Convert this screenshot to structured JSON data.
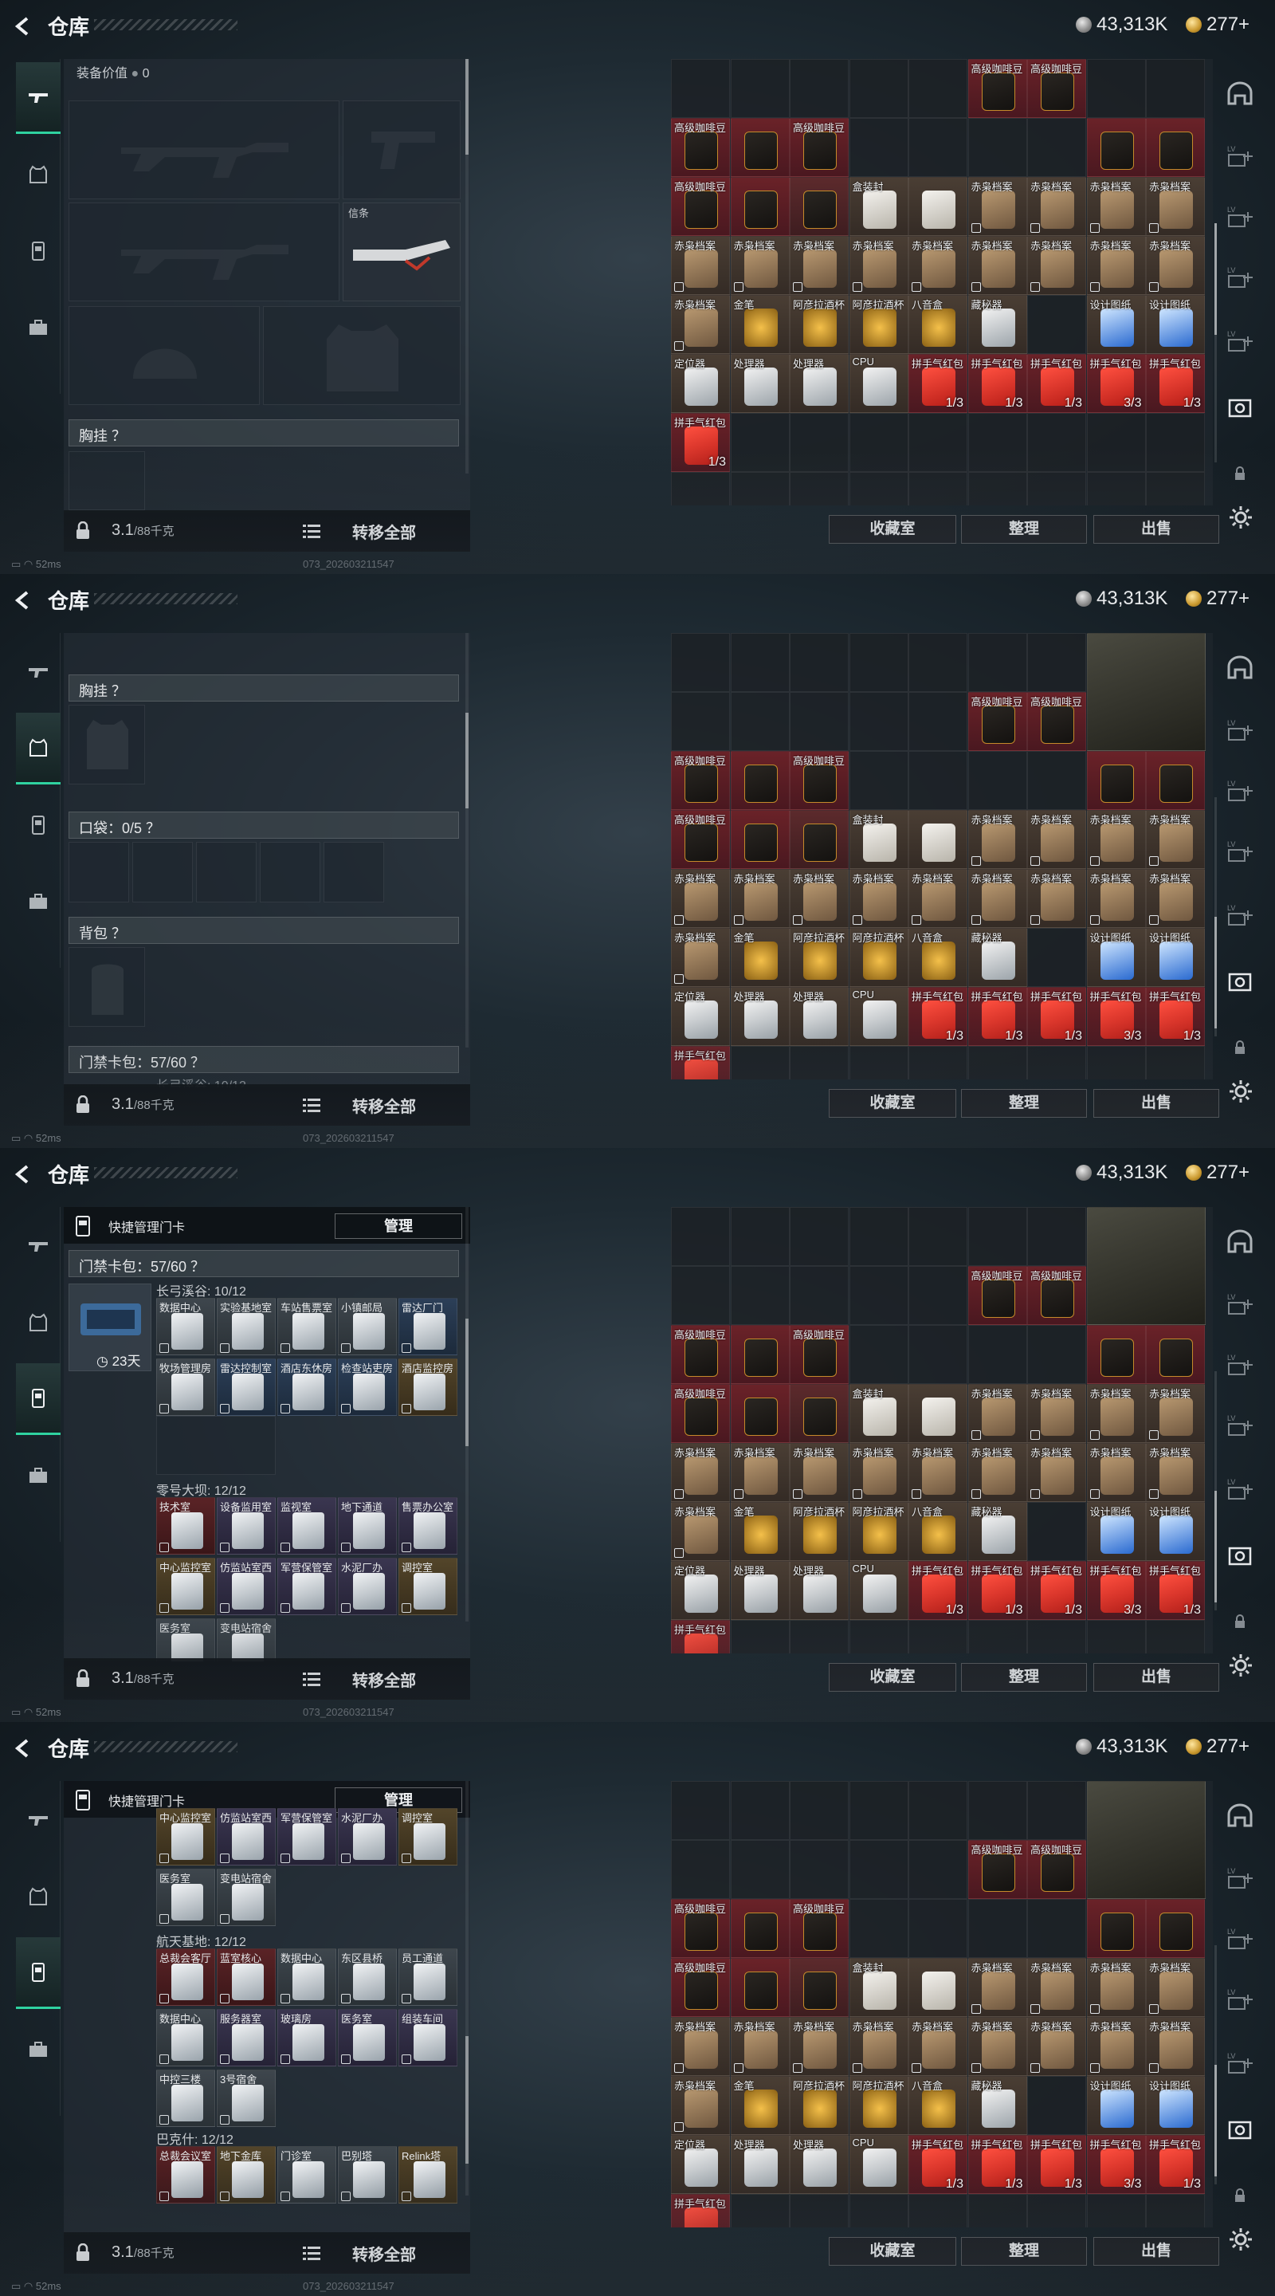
{
  "header": {
    "title": "仓库",
    "currency_silver": "43,313K",
    "currency_gold": "277+"
  },
  "status": {
    "ping": "52ms",
    "build": "073_202603211547"
  },
  "bottom": {
    "weight": "3.1",
    "weight_cap": "/88千克",
    "transfer_all": "转移全部"
  },
  "nav": [
    "firearm-tab",
    "armor-tab",
    "keycard-tab",
    "briefcase-tab"
  ],
  "loadout": {
    "equip_value_label": "装备价值",
    "equip_value": "0",
    "melee_label": "信条",
    "chest_rig": "胸挂 ？",
    "pocket": "口袋：0/5 ？",
    "backpack": "背包 ？",
    "keycard_pack": "门禁卡包：57/60 ？",
    "changgong_sub": "长弓溪谷: 10/12"
  },
  "keycard": {
    "manage_title": "快捷管理门卡",
    "manage_button": "管理",
    "case_timer": "23天",
    "group1_title": "长弓溪谷: 10/12",
    "group1": [
      "数据中心",
      "实验基地室",
      "车站售票室",
      "小镇邮局",
      "雷达厂门",
      "牧场管理房",
      "雷达控制室",
      "酒店东休房",
      "检查站吏房",
      "酒店监控房"
    ],
    "group2_title": "零号大坝: 12/12",
    "group2": [
      "技术室",
      "设备监用室",
      "监视室",
      "地下通道",
      "售票办公室",
      "中心监控室",
      "仿监站室西",
      "军营保管室",
      "水泥厂办",
      "调控室",
      "医务室",
      "变电站宿舍"
    ],
    "group3_title": "航天基地: 12/12",
    "group3": [
      "总裁会客厅",
      "蓝室核心",
      "数据中心",
      "东区县桥",
      "员工通道",
      "数据中心",
      "服务器室",
      "玻璃房",
      "医务室",
      "组装车间",
      "中控三楼",
      "3号宿舍"
    ],
    "group4_title": "巴克什: 12/12",
    "group4": [
      "总裁会议室",
      "地下金库",
      "门诊室",
      "巴别塔",
      "Relink塔"
    ],
    "group2_partial": [
      "中心监控室",
      "仿监站室西",
      "军营保管室",
      "水泥厂办",
      "调控室"
    ]
  },
  "stash": {
    "coffee": "高级咖啡豆",
    "case": "盒装封装咖啡",
    "case_short": "盒装封",
    "pheasant": "赤枭档案",
    "pen": "金笔",
    "cup": "阿彦拉酒杯",
    "clock": "八音盒",
    "secret": "藏秘器",
    "drawing": "设计图纸",
    "locator": "定位器",
    "processor": "处理器",
    "cpu": "CPU",
    "hongbao": "拼手气红包",
    "c13": "1/3",
    "c33": "3/3"
  },
  "buttons": {
    "collection": "收藏室",
    "sort": "整理",
    "sell": "出售"
  },
  "colors": {
    "accent": "#2fd2a0",
    "slot_red": "#6a2228",
    "gold": "#c9982e"
  }
}
